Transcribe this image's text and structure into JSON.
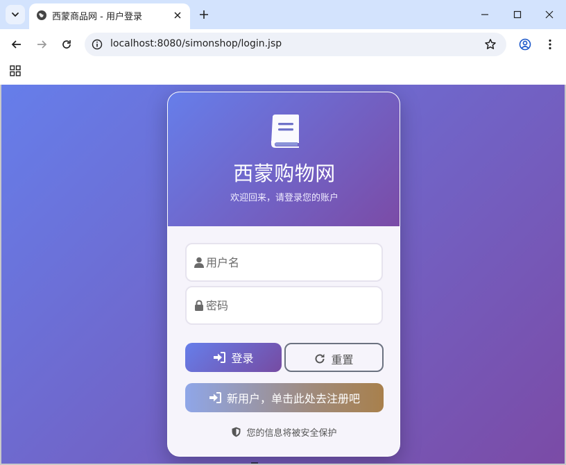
{
  "browser": {
    "tab_title": "西蒙商品网 - 用户登录",
    "url": "localhost:8080/simonshop/login.jsp"
  },
  "login": {
    "brand": "西蒙购物网",
    "subtitle": "欢迎回来，请登录您的账户",
    "username_placeholder": "用户名",
    "password_placeholder": "密码",
    "login_label": "登录",
    "reset_label": "重置",
    "register_label": "新用户，单击此处去注册吧",
    "secure_note": "您的信息将被安全保护"
  },
  "colors": {
    "gradient_start": "#667eea",
    "gradient_end": "#7b4ba6",
    "tabbar": "#d3e3fd"
  },
  "icons": [
    "tab-list-icon",
    "globe-icon",
    "close-icon",
    "plus-icon",
    "minimize-icon",
    "maximize-icon",
    "back-icon",
    "forward-icon",
    "reload-icon",
    "site-info-icon",
    "star-icon",
    "profile-icon",
    "more-icon",
    "apps-icon",
    "book-icon",
    "user-icon",
    "lock-icon",
    "sign-in-icon",
    "redo-icon",
    "shield-icon"
  ]
}
